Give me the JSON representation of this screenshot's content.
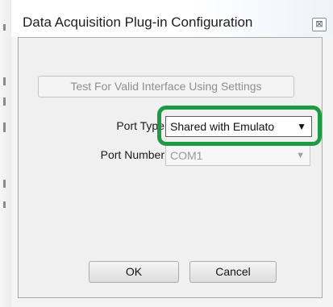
{
  "dialog": {
    "title": "Data Acquisition Plug-in Configuration",
    "close_glyph": "⊠"
  },
  "form": {
    "test_button_label": "Test For Valid Interface Using Settings",
    "test_button_enabled": false,
    "port_type": {
      "label": "Port Type",
      "value": "Shared with Emulato"
    },
    "port_number": {
      "label": "Port Number",
      "value": "COM1",
      "enabled": false
    }
  },
  "buttons": {
    "ok_label": "OK",
    "cancel_label": "Cancel"
  },
  "icons": {
    "close": "close-icon",
    "dropdown": "chevron-down-icon"
  },
  "colors": {
    "highlight": "#1d9a43",
    "dialog_bg": "#f0f0f0",
    "disabled_text": "#8e8e8e"
  }
}
